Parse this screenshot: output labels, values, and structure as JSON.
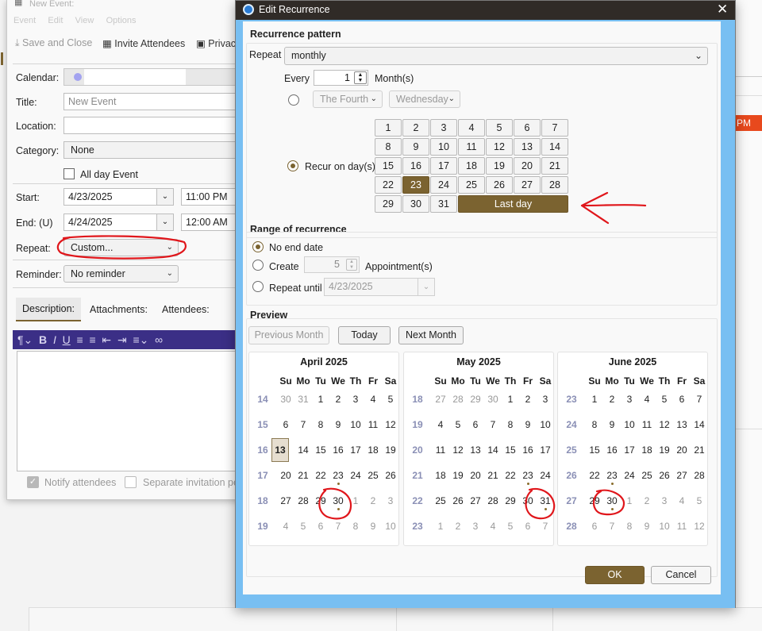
{
  "background_window": {
    "title": "New Event:",
    "menubar": [
      "Event",
      "Edit",
      "View",
      "Options"
    ],
    "toolbar": {
      "save_close": "Save and Close",
      "invite": "Invite Attendees",
      "privacy": "Privacy"
    },
    "labels": {
      "calendar": "Calendar:",
      "title": "Title:",
      "location": "Location:",
      "category": "Category:",
      "start": "Start:",
      "end": "End: (U)",
      "repeat": "Repeat:",
      "reminder": "Reminder:"
    },
    "title_placeholder": "New Event",
    "category_value": "None",
    "all_day_label": "All day Event",
    "start_date": "4/23/2025",
    "start_time": "11:00 PM",
    "end_date": "4/24/2025",
    "end_time": "12:00 AM",
    "repeat_value": "Custom...",
    "reminder_value": "No reminder",
    "tabs": [
      "Description:",
      "Attachments:",
      "Attendees:"
    ],
    "notify_label": "Notify attendees",
    "separate_label": "Separate invitation per"
  },
  "right_partial": {
    "pm": "PM"
  },
  "dialog": {
    "title": "Edit Recurrence",
    "pattern_heading": "Recurrence pattern",
    "repeat_label": "Repeat",
    "repeat_value": "monthly",
    "every_label": "Every",
    "every_value": "1",
    "months_label": "Month(s)",
    "ordinal_value": "The Fourth",
    "weekday_value": "Wednesday",
    "recur_on_days_label": "Recur on day(s)",
    "day_buttons": [
      "1",
      "2",
      "3",
      "4",
      "5",
      "6",
      "7",
      "8",
      "9",
      "10",
      "11",
      "12",
      "13",
      "14",
      "15",
      "16",
      "17",
      "18",
      "19",
      "20",
      "21",
      "22",
      "23",
      "24",
      "25",
      "26",
      "27",
      "28",
      "29",
      "30",
      "31"
    ],
    "selected_day": "23",
    "last_day_label": "Last day",
    "range_heading": "Range of recurrence",
    "no_end_label": "No end date",
    "create_label": "Create",
    "create_value": "5",
    "appointments_label": "Appointment(s)",
    "repeat_until_label": "Repeat until",
    "until_value": "4/23/2025",
    "preview_heading": "Preview",
    "prev_month": "Previous Month",
    "today": "Today",
    "next_month": "Next Month",
    "weekday_headers": [
      "Su",
      "Mo",
      "Tu",
      "We",
      "Th",
      "Fr",
      "Sa"
    ],
    "ok": "OK",
    "cancel": "Cancel"
  },
  "months": [
    {
      "title": "April 2025",
      "weeks": [
        "14",
        "15",
        "16",
        "17",
        "18",
        "19"
      ],
      "days": [
        [
          "30",
          "31",
          "1",
          "2",
          "3",
          "4",
          "5"
        ],
        [
          "6",
          "7",
          "8",
          "9",
          "10",
          "11",
          "12"
        ],
        [
          "13",
          "14",
          "15",
          "16",
          "17",
          "18",
          "19"
        ],
        [
          "20",
          "21",
          "22",
          "23",
          "24",
          "25",
          "26"
        ],
        [
          "27",
          "28",
          "29",
          "30",
          "1",
          "2",
          "3"
        ],
        [
          "4",
          "5",
          "6",
          "7",
          "8",
          "9",
          "10"
        ]
      ],
      "out": [
        [
          1,
          1,
          0,
          0,
          0,
          0,
          0
        ],
        [
          0,
          0,
          0,
          0,
          0,
          0,
          0
        ],
        [
          0,
          0,
          0,
          0,
          0,
          0,
          0
        ],
        [
          0,
          0,
          0,
          0,
          0,
          0,
          0
        ],
        [
          0,
          0,
          0,
          0,
          1,
          1,
          1
        ],
        [
          1,
          1,
          1,
          1,
          1,
          1,
          1
        ]
      ],
      "today": [
        2,
        0
      ],
      "dots": [
        [
          3,
          3
        ],
        [
          4,
          3
        ]
      ]
    },
    {
      "title": "May 2025",
      "weeks": [
        "18",
        "19",
        "20",
        "21",
        "22",
        "23"
      ],
      "days": [
        [
          "27",
          "28",
          "29",
          "30",
          "1",
          "2",
          "3"
        ],
        [
          "4",
          "5",
          "6",
          "7",
          "8",
          "9",
          "10"
        ],
        [
          "11",
          "12",
          "13",
          "14",
          "15",
          "16",
          "17"
        ],
        [
          "18",
          "19",
          "20",
          "21",
          "22",
          "23",
          "24"
        ],
        [
          "25",
          "26",
          "27",
          "28",
          "29",
          "30",
          "31"
        ],
        [
          "1",
          "2",
          "3",
          "4",
          "5",
          "6",
          "7"
        ]
      ],
      "out": [
        [
          1,
          1,
          1,
          1,
          0,
          0,
          0
        ],
        [
          0,
          0,
          0,
          0,
          0,
          0,
          0
        ],
        [
          0,
          0,
          0,
          0,
          0,
          0,
          0
        ],
        [
          0,
          0,
          0,
          0,
          0,
          0,
          0
        ],
        [
          0,
          0,
          0,
          0,
          0,
          0,
          0
        ],
        [
          1,
          1,
          1,
          1,
          1,
          1,
          1
        ]
      ],
      "today": null,
      "dots": [
        [
          3,
          5
        ],
        [
          4,
          6
        ]
      ]
    },
    {
      "title": "June 2025",
      "weeks": [
        "23",
        "24",
        "25",
        "26",
        "27",
        "28"
      ],
      "days": [
        [
          "1",
          "2",
          "3",
          "4",
          "5",
          "6",
          "7"
        ],
        [
          "8",
          "9",
          "10",
          "11",
          "12",
          "13",
          "14"
        ],
        [
          "15",
          "16",
          "17",
          "18",
          "19",
          "20",
          "21"
        ],
        [
          "22",
          "23",
          "24",
          "25",
          "26",
          "27",
          "28"
        ],
        [
          "29",
          "30",
          "1",
          "2",
          "3",
          "4",
          "5"
        ],
        [
          "6",
          "7",
          "8",
          "9",
          "10",
          "11",
          "12"
        ]
      ],
      "out": [
        [
          0,
          0,
          0,
          0,
          0,
          0,
          0
        ],
        [
          0,
          0,
          0,
          0,
          0,
          0,
          0
        ],
        [
          0,
          0,
          0,
          0,
          0,
          0,
          0
        ],
        [
          0,
          0,
          0,
          0,
          0,
          0,
          0
        ],
        [
          0,
          0,
          1,
          1,
          1,
          1,
          1
        ],
        [
          1,
          1,
          1,
          1,
          1,
          1,
          1
        ]
      ],
      "today": null,
      "dots": [
        [
          3,
          1
        ],
        [
          4,
          1
        ]
      ]
    }
  ],
  "colors": {
    "accent": "#7b6330",
    "titlebar": "#302b27",
    "frame": "#78bff2",
    "annotation": "#e0161b",
    "editor_toolbar": "#3b2f86"
  }
}
